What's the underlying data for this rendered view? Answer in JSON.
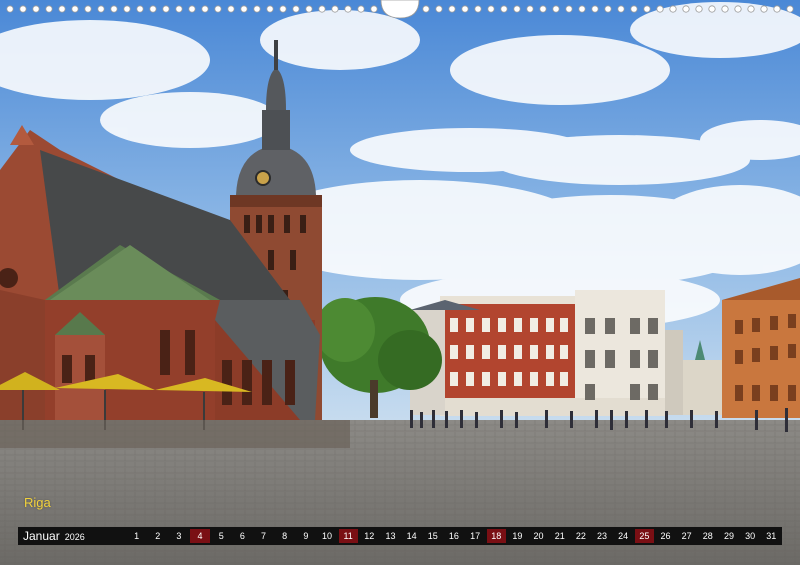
{
  "caption": "Riga",
  "calendar": {
    "month": "Januar",
    "year": "2026",
    "days": [
      "1",
      "2",
      "3",
      "4",
      "5",
      "6",
      "7",
      "8",
      "9",
      "10",
      "11",
      "12",
      "13",
      "14",
      "15",
      "16",
      "17",
      "18",
      "19",
      "20",
      "21",
      "22",
      "23",
      "24",
      "25",
      "26",
      "27",
      "28",
      "29",
      "30",
      "31"
    ],
    "sundays": [
      "4",
      "11",
      "18",
      "25"
    ],
    "sunday_color": "#7a0f14",
    "bar_color": "#111111"
  },
  "caption_color": "#f2d23c"
}
